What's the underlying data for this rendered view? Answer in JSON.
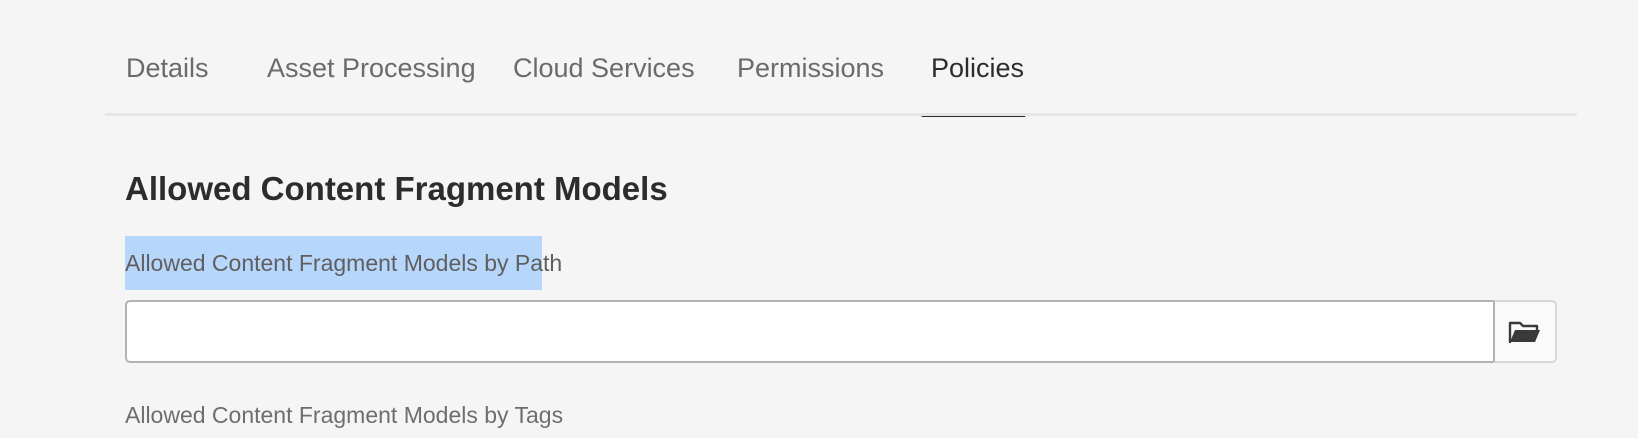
{
  "tabs": [
    {
      "label": "Details",
      "active": false
    },
    {
      "label": "Asset Processing",
      "active": false
    },
    {
      "label": "Cloud Services",
      "active": false
    },
    {
      "label": "Permissions",
      "active": false
    },
    {
      "label": "Policies",
      "active": true
    }
  ],
  "section": {
    "title": "Allowed Content Fragment Models"
  },
  "fields": {
    "by_path": {
      "label": "Allowed Content Fragment Models by Path",
      "value": "",
      "browse_icon": "folder-open-icon"
    },
    "by_tags": {
      "label": "Allowed Content Fragment Models by Tags"
    }
  },
  "colors": {
    "selection_highlight": "#b7d6fb",
    "active_tab_indicator": "#2c2c2c",
    "page_background": "#f5f5f5"
  }
}
